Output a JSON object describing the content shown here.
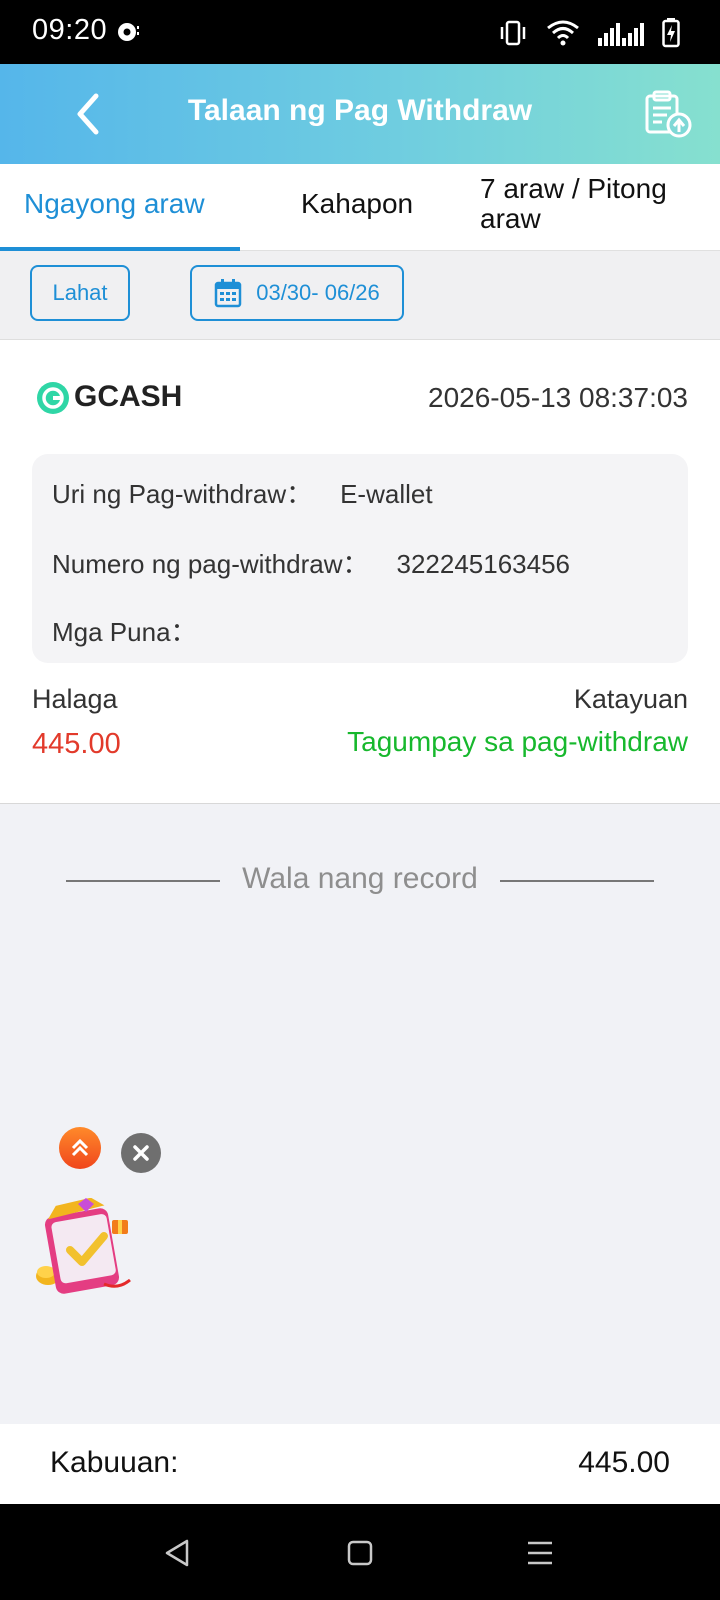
{
  "status_bar": {
    "time": "09:20"
  },
  "header": {
    "title": "Talaan ng Pag Withdraw"
  },
  "tabs": [
    {
      "label": "Ngayong araw",
      "active": true
    },
    {
      "label": "Kahapon",
      "active": false
    },
    {
      "label": "7 araw / Pitong araw",
      "active": false
    }
  ],
  "filters": {
    "all_label": "Lahat",
    "date_range": "03/30- 06/26"
  },
  "record": {
    "method": "GCASH",
    "datetime": "2026-05-13 08:37:03",
    "type_label": "Uri ng Pag-withdraw：",
    "type_value": "E-wallet",
    "number_label": "Numero ng pag-withdraw：",
    "number_value": "322245163456",
    "remarks_label": "Mga Puna：",
    "remarks_value": "",
    "amount_label": "Halaga",
    "amount_value": "445.00",
    "status_label": "Katayuan",
    "status_value": "Tagumpay sa pag-withdraw"
  },
  "no_more_records": "Wala nang record",
  "total": {
    "label": "Kabuuan:",
    "value": "445.00"
  },
  "colors": {
    "accent": "#1e8fd6",
    "amount": "#e23a2b",
    "success": "#17b82d",
    "header_gradient_start": "#55b6ea",
    "header_gradient_end": "#86e0cf"
  },
  "icons": {
    "back": "back-arrow-icon",
    "export": "clipboard-upload-icon",
    "calendar": "calendar-icon",
    "gcash": "gcash-logo-icon",
    "scroll_top": "double-chevron-up-icon",
    "close": "close-icon",
    "nav_back": "nav-back-icon",
    "nav_home": "nav-home-icon",
    "nav_menu": "nav-menu-icon"
  }
}
